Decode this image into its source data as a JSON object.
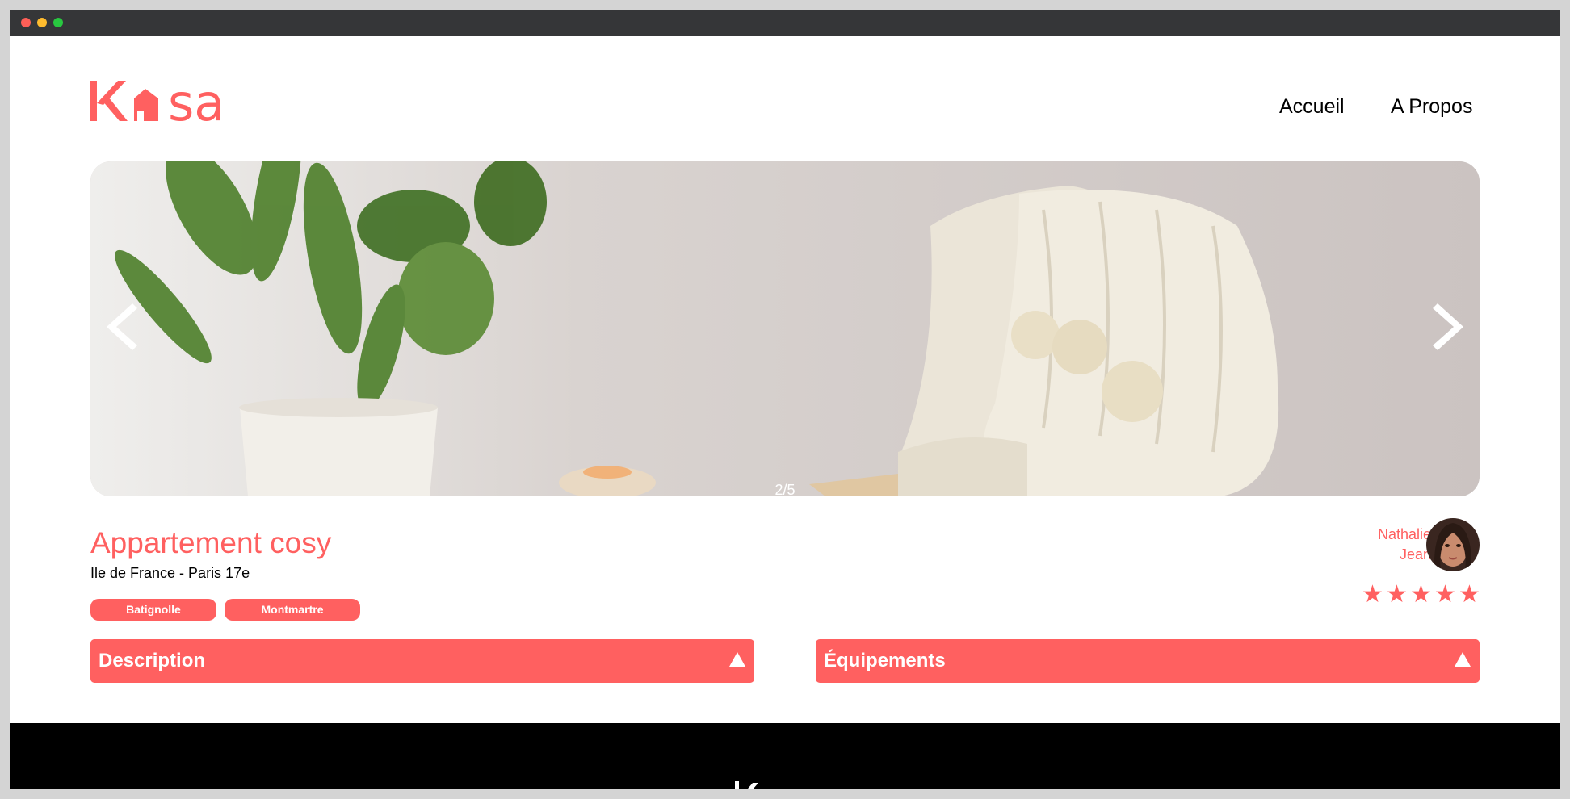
{
  "window": {
    "controls": [
      "close",
      "minimize",
      "maximize"
    ]
  },
  "brand": {
    "name": "Kasa",
    "color": "#ff6060"
  },
  "nav": {
    "home_label": "Accueil",
    "about_label": "A Propos"
  },
  "carousel": {
    "counter": "2/5",
    "prev_icon": "chevron-left-icon",
    "next_icon": "chevron-right-icon"
  },
  "listing": {
    "title": "Appartement cosy",
    "location": "Ile de France - Paris 17e",
    "tags": [
      "Batignolle",
      "Montmartre"
    ],
    "host": {
      "first_name": "Nathalie",
      "last_name": "Jean"
    },
    "rating": 5,
    "rating_max": 5
  },
  "collapses": [
    {
      "label": "Description",
      "icon": "caret-up-icon"
    },
    {
      "label": "Équipements",
      "icon": "caret-up-icon"
    }
  ],
  "footer": {
    "logo": "Kasa"
  }
}
